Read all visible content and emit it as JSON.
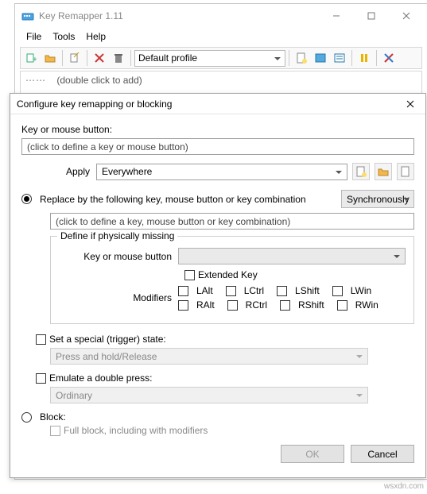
{
  "app": {
    "title": "Key Remapper 1.11",
    "menus": [
      "File",
      "Tools",
      "Help"
    ],
    "profile": "Default profile",
    "tree_hint": "(double click to add)"
  },
  "dialog": {
    "title": "Configure key remapping or blocking",
    "key_label": "Key or mouse button:",
    "key_placeholder": "(click to define a key or mouse button)",
    "apply_label": "Apply",
    "apply_value": "Everywhere",
    "replace_label": "Replace by the following key, mouse button or key combination",
    "sync_value": "Synchronously",
    "combo_placeholder": "(click to define a key, mouse button or key combination)",
    "define_group": "Define if physically missing",
    "km_label": "Key or mouse button",
    "ext_key": "Extended Key",
    "mods_label": "Modifiers",
    "mods": [
      "LAlt",
      "LCtrl",
      "LShift",
      "LWin",
      "RAlt",
      "RCtrl",
      "RShift",
      "RWin"
    ],
    "special_state": "Set a special (trigger) state:",
    "special_value": "Press and hold/Release",
    "emulate": "Emulate a double press:",
    "emulate_value": "Ordinary",
    "block": "Block:",
    "fullblock": "Full block, including with modifiers",
    "ok": "OK",
    "cancel": "Cancel"
  },
  "watermark": "wsxdn.com"
}
